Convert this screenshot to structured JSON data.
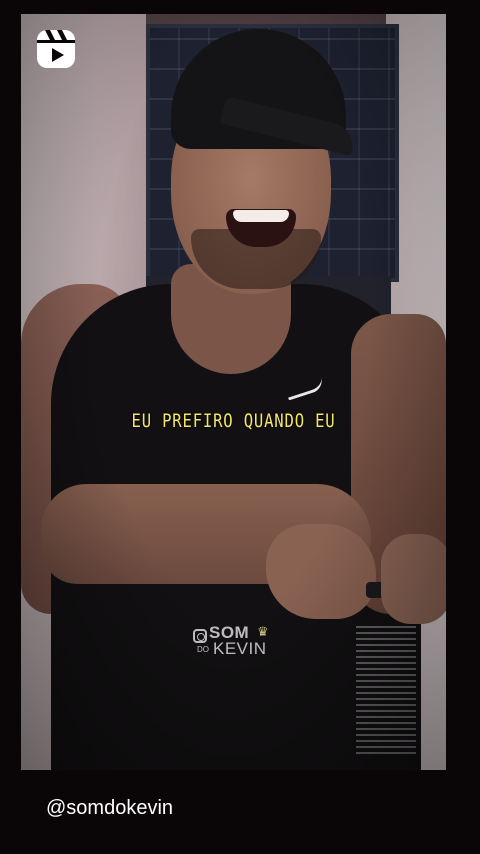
{
  "post": {
    "lyric_caption": "EU PREFIRO QUANDO EU",
    "watermark": {
      "line1": "SOM",
      "line2_small": "DO",
      "line2": "KEVIN"
    },
    "username": "@somdokevin"
  },
  "icons": {
    "reels": "reels-icon",
    "watermark_instagram": "instagram-icon",
    "watermark_crown": "crown-icon"
  },
  "colors": {
    "background": "#000000",
    "lyric": "#f2e56a",
    "username": "#ffffff"
  }
}
